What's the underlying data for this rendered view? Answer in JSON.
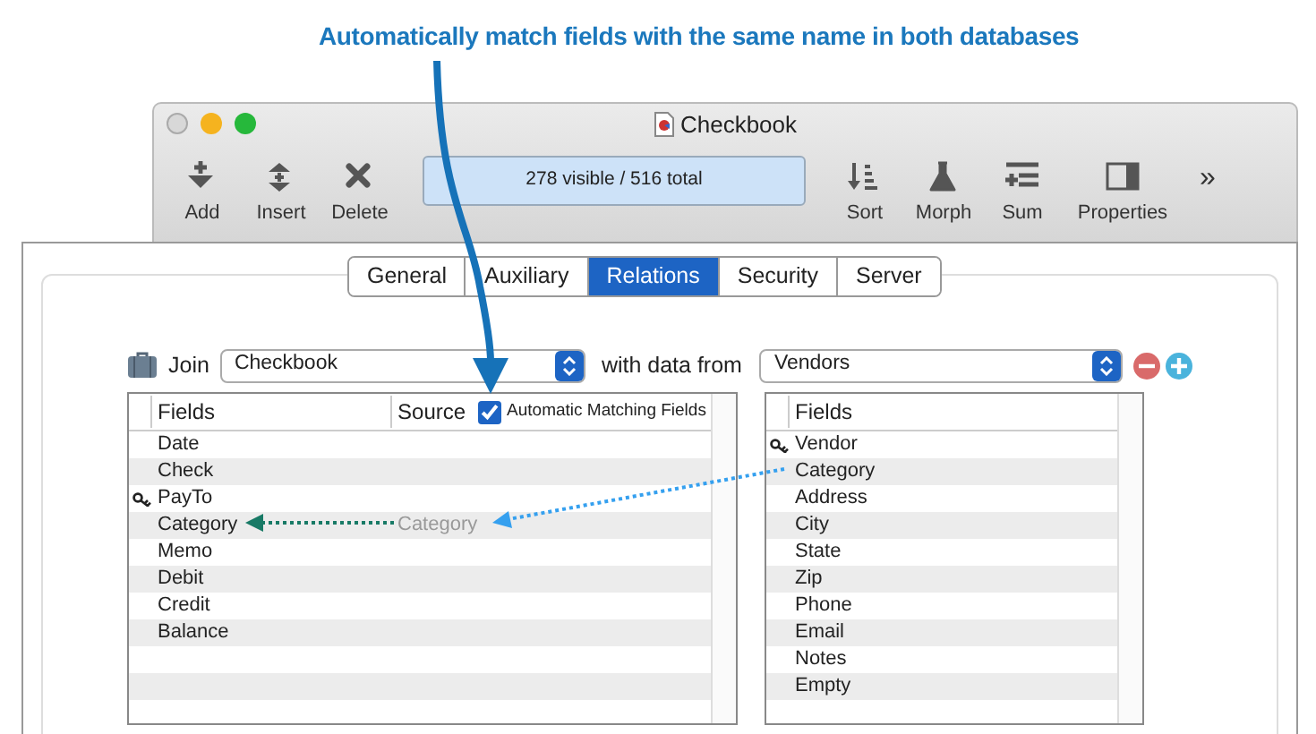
{
  "callout": "Automatically match fields with the same name in both databases",
  "window": {
    "title": "Checkbook"
  },
  "toolbar": {
    "left": [
      {
        "kind": "add",
        "label": "Add"
      },
      {
        "kind": "insert",
        "label": "Insert"
      },
      {
        "kind": "delete",
        "label": "Delete"
      }
    ],
    "record_count": "278 visible / 516 total",
    "right": [
      {
        "kind": "sort",
        "label": "Sort"
      },
      {
        "kind": "morph",
        "label": "Morph"
      },
      {
        "kind": "sum",
        "label": "Sum"
      },
      {
        "kind": "properties",
        "label": "Properties"
      }
    ],
    "overflow": "»"
  },
  "tabs": [
    {
      "label": "General",
      "selected": false
    },
    {
      "label": "Auxiliary",
      "selected": false
    },
    {
      "label": "Relations",
      "selected": true
    },
    {
      "label": "Security",
      "selected": false
    },
    {
      "label": "Server",
      "selected": false
    }
  ],
  "join": {
    "label": "Join",
    "database": "Checkbook",
    "with_label": "with data from",
    "source_database": "Vendors"
  },
  "left_table": {
    "columns": [
      "Fields",
      "Source"
    ],
    "auto_match": {
      "label": "Automatic Matching Fields",
      "checked": true
    },
    "rows": [
      {
        "name": "Date",
        "key": false
      },
      {
        "name": "Check",
        "key": false
      },
      {
        "name": "PayTo",
        "key": true
      },
      {
        "name": "Category",
        "key": false,
        "source": "Category"
      },
      {
        "name": "Memo",
        "key": false
      },
      {
        "name": "Debit",
        "key": false
      },
      {
        "name": "Credit",
        "key": false
      },
      {
        "name": "Balance",
        "key": false
      }
    ]
  },
  "right_table": {
    "columns": [
      "Fields"
    ],
    "rows": [
      {
        "name": "Vendor",
        "key": true
      },
      {
        "name": "Category",
        "key": false
      },
      {
        "name": "Address",
        "key": false
      },
      {
        "name": "City",
        "key": false
      },
      {
        "name": "State",
        "key": false
      },
      {
        "name": "Zip",
        "key": false
      },
      {
        "name": "Phone",
        "key": false
      },
      {
        "name": "Email",
        "key": false
      },
      {
        "name": "Notes",
        "key": false
      },
      {
        "name": "Empty",
        "key": false
      }
    ]
  }
}
